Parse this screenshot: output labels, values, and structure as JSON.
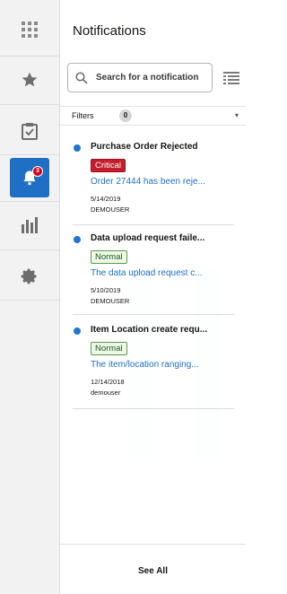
{
  "rail": {
    "items": [
      {
        "icon": "apps-grid-icon"
      },
      {
        "icon": "star-icon"
      },
      {
        "icon": "clipboard-check-icon"
      },
      {
        "icon": "notification-bell-icon",
        "active": true,
        "badge": "3"
      },
      {
        "icon": "bar-chart-icon"
      },
      {
        "icon": "gear-icon"
      }
    ]
  },
  "panel": {
    "title": "Notifications",
    "search_placeholder": "Search for a notification",
    "filters_label": "Filters",
    "filters_count": "0",
    "see_all": "See All"
  },
  "notifications": [
    {
      "title": "Purchase Order Rejected",
      "severity": "Critical",
      "description": "Order 27444 has been reje...",
      "date": "5/14/2019",
      "user": "DEMOUSER"
    },
    {
      "title": "Data upload request faile...",
      "severity": "Normal",
      "description": "The data upload request c...",
      "date": "5/10/2019",
      "user": "DEMOUSER"
    },
    {
      "title": "Item Location create requ...",
      "severity": "Normal",
      "description": "The item/location ranging...",
      "date": "12/14/2018",
      "user": "demouser"
    }
  ],
  "colors": {
    "accent": "#1f6fc4",
    "critical": "#c41e2c",
    "normal_text": "#1c5d16",
    "unread_dot": "#1f75d1"
  }
}
